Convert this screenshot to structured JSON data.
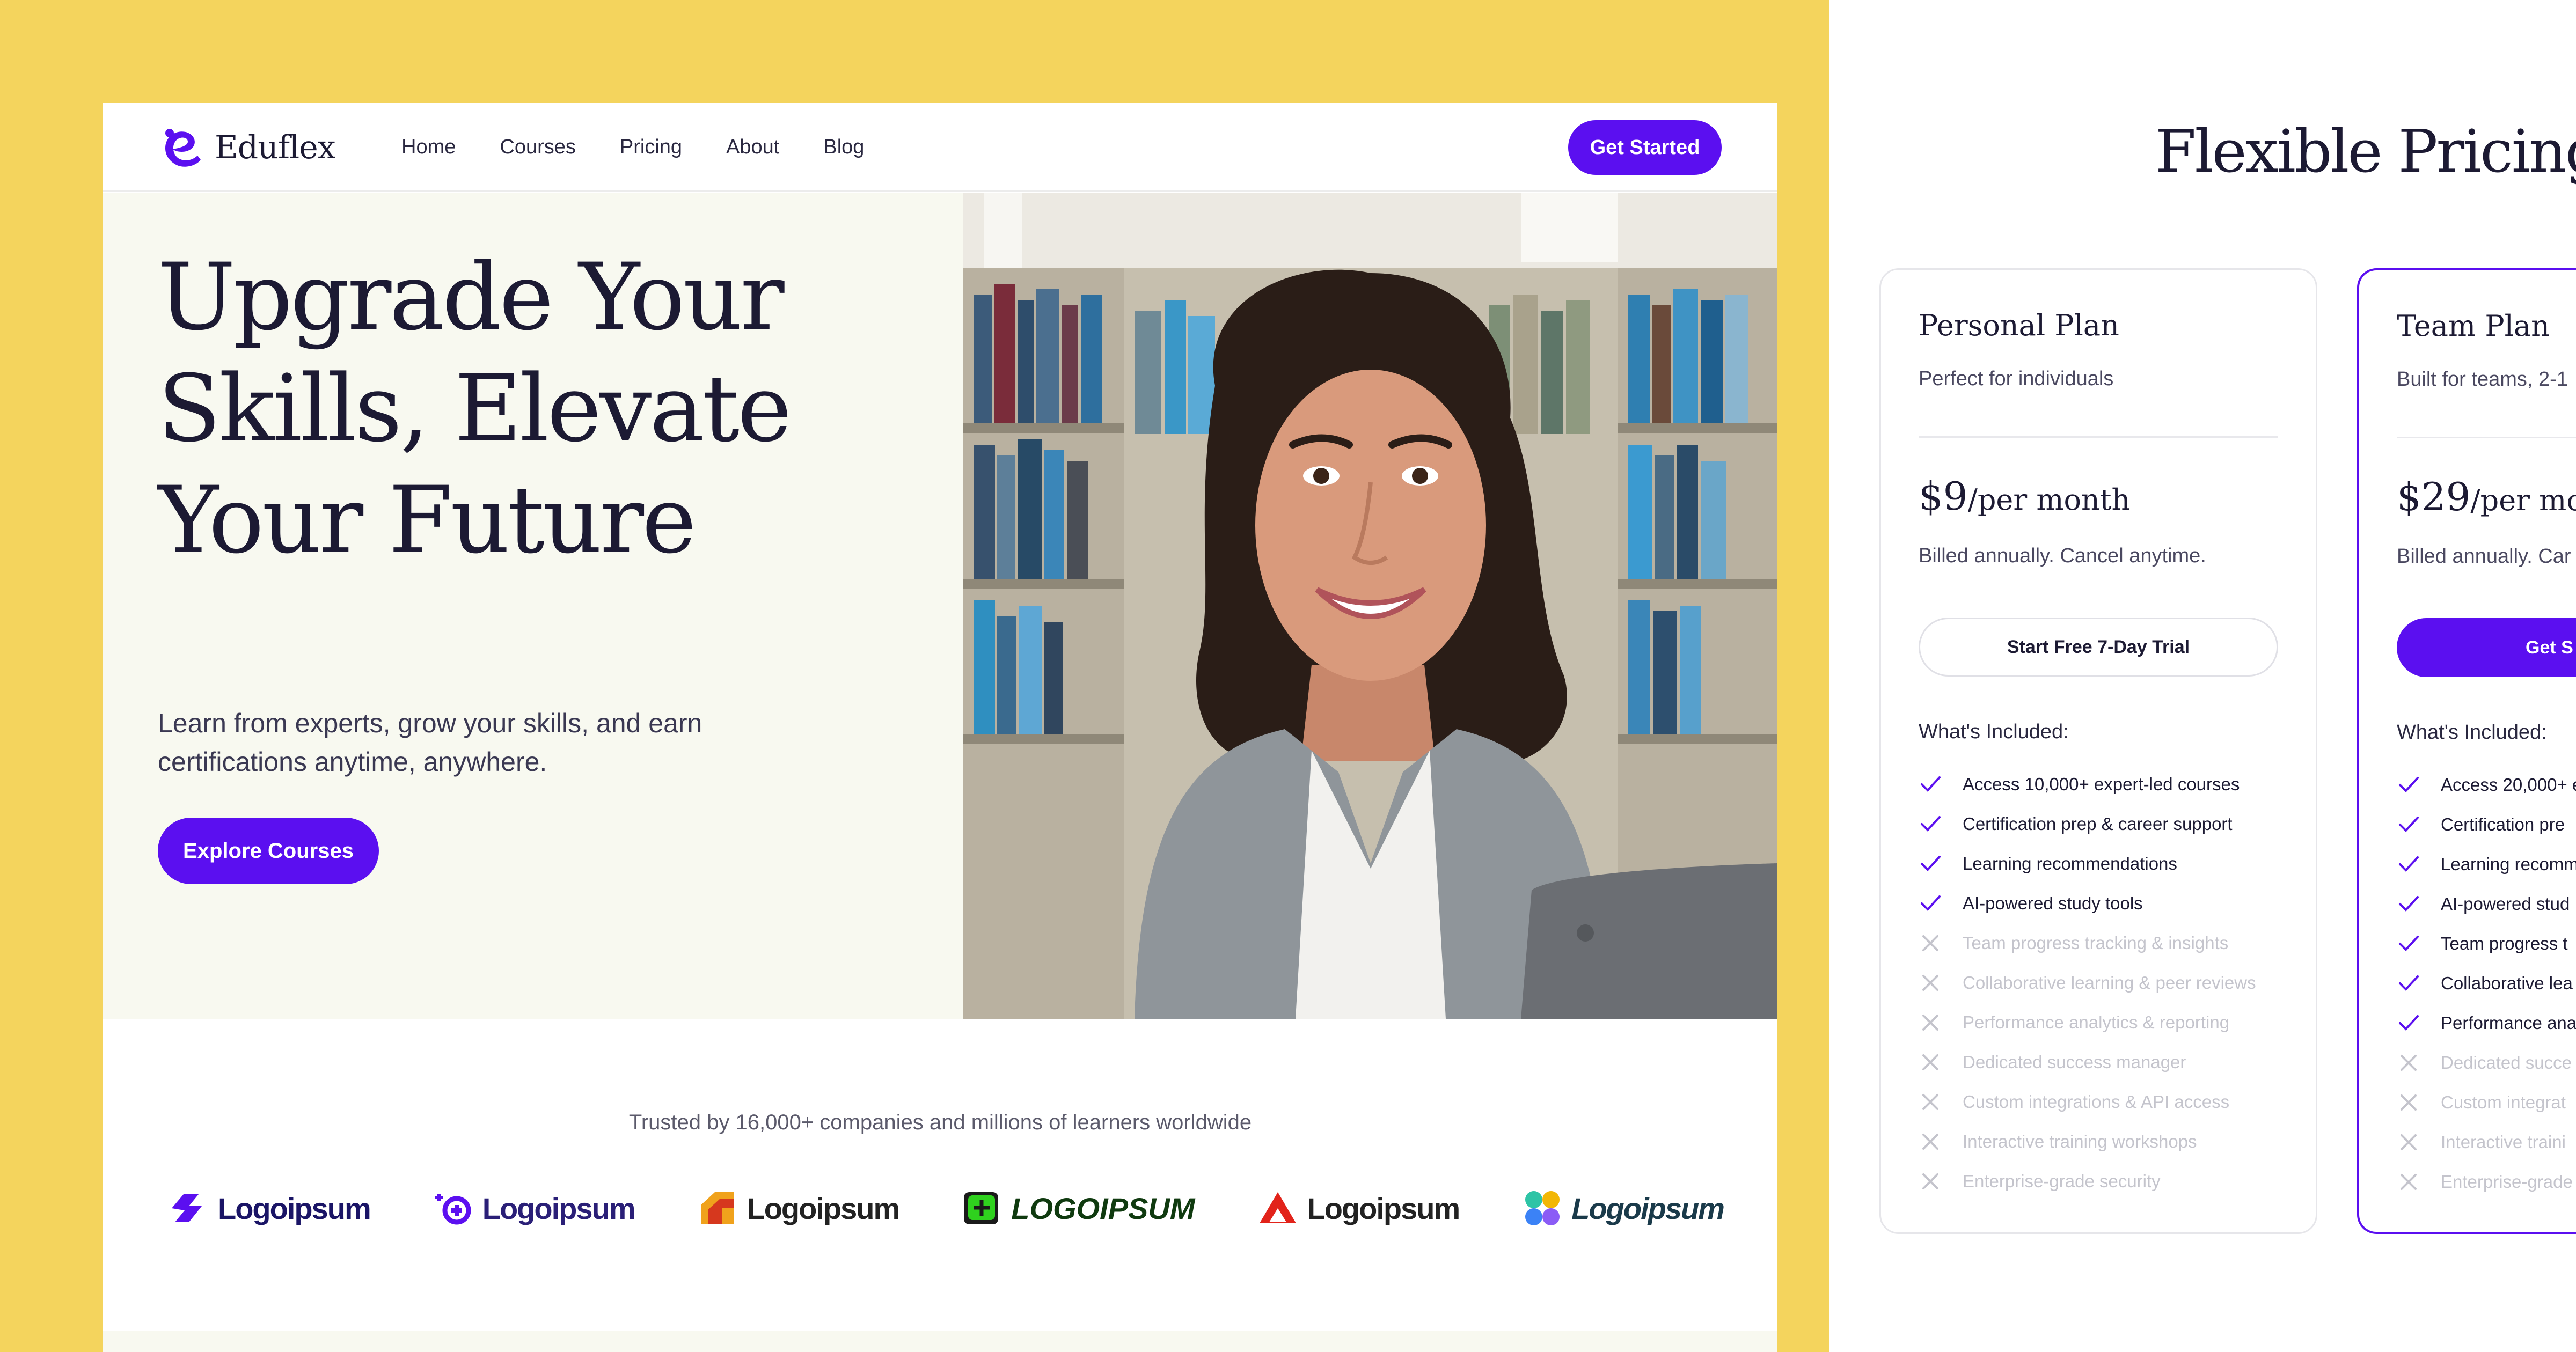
{
  "colors": {
    "accent": "#5b0ff0",
    "background_left": "#f4d45d",
    "hero_bg": "#f8f9f0"
  },
  "nav": {
    "brand": "Eduflex",
    "links": [
      "Home",
      "Courses",
      "Pricing",
      "About",
      "Blog"
    ],
    "cta": "Get Started",
    "search_icon": "search-icon"
  },
  "hero": {
    "title_lines": [
      "Upgrade Your",
      "Skills, Elevate",
      "Your Future"
    ],
    "subtitle_lines": [
      "Learn from experts, grow your skills, and earn",
      "certifications anytime, anywhere."
    ],
    "button": "Explore Courses"
  },
  "trusted": {
    "text": "Trusted by 16,000+ companies and millions of learners worldwide",
    "logos": [
      "Logoipsum",
      "Logoipsum",
      "Logoipsum",
      "LOGOIPSUM",
      "Logoipsum",
      "Logoipsum"
    ]
  },
  "pricing": {
    "title": "Flexible Pricing f",
    "plans": [
      {
        "name": "Personal Plan",
        "desc": "Perfect for individuals",
        "price": "$9",
        "period": "/per month",
        "billed": "Billed annually. Cancel anytime.",
        "button": "Start Free 7-Day Trial",
        "included_label": "What's Included:",
        "features": [
          {
            "text": "Access 10,000+ expert-led courses",
            "on": true
          },
          {
            "text": "Certification prep & career support",
            "on": true
          },
          {
            "text": "Learning recommendations",
            "on": true
          },
          {
            "text": "AI-powered study tools",
            "on": true
          },
          {
            "text": "Team progress tracking & insights",
            "on": false
          },
          {
            "text": "Collaborative learning & peer reviews",
            "on": false
          },
          {
            "text": "Performance analytics & reporting",
            "on": false
          },
          {
            "text": "Dedicated success manager",
            "on": false
          },
          {
            "text": "Custom integrations & API access",
            "on": false
          },
          {
            "text": "Interactive training workshops",
            "on": false
          },
          {
            "text": "Enterprise-grade security",
            "on": false
          }
        ]
      },
      {
        "name": "Team Plan",
        "desc": "Built for teams, 2-1",
        "price": "$29",
        "period": "/per mon",
        "billed": "Billed annually. Car",
        "button": "Get S",
        "included_label": "What's Included:",
        "features": [
          {
            "text": "Access 20,000+ e",
            "on": true
          },
          {
            "text": "Certification pre",
            "on": true
          },
          {
            "text": "Learning recomm",
            "on": true
          },
          {
            "text": "AI-powered stud",
            "on": true
          },
          {
            "text": "Team progress t",
            "on": true
          },
          {
            "text": "Collaborative lea",
            "on": true
          },
          {
            "text": "Performance ana",
            "on": true
          },
          {
            "text": "Dedicated succe",
            "on": false
          },
          {
            "text": "Custom integrat",
            "on": false
          },
          {
            "text": "Interactive traini",
            "on": false
          },
          {
            "text": "Enterprise-grade",
            "on": false
          }
        ]
      }
    ]
  }
}
